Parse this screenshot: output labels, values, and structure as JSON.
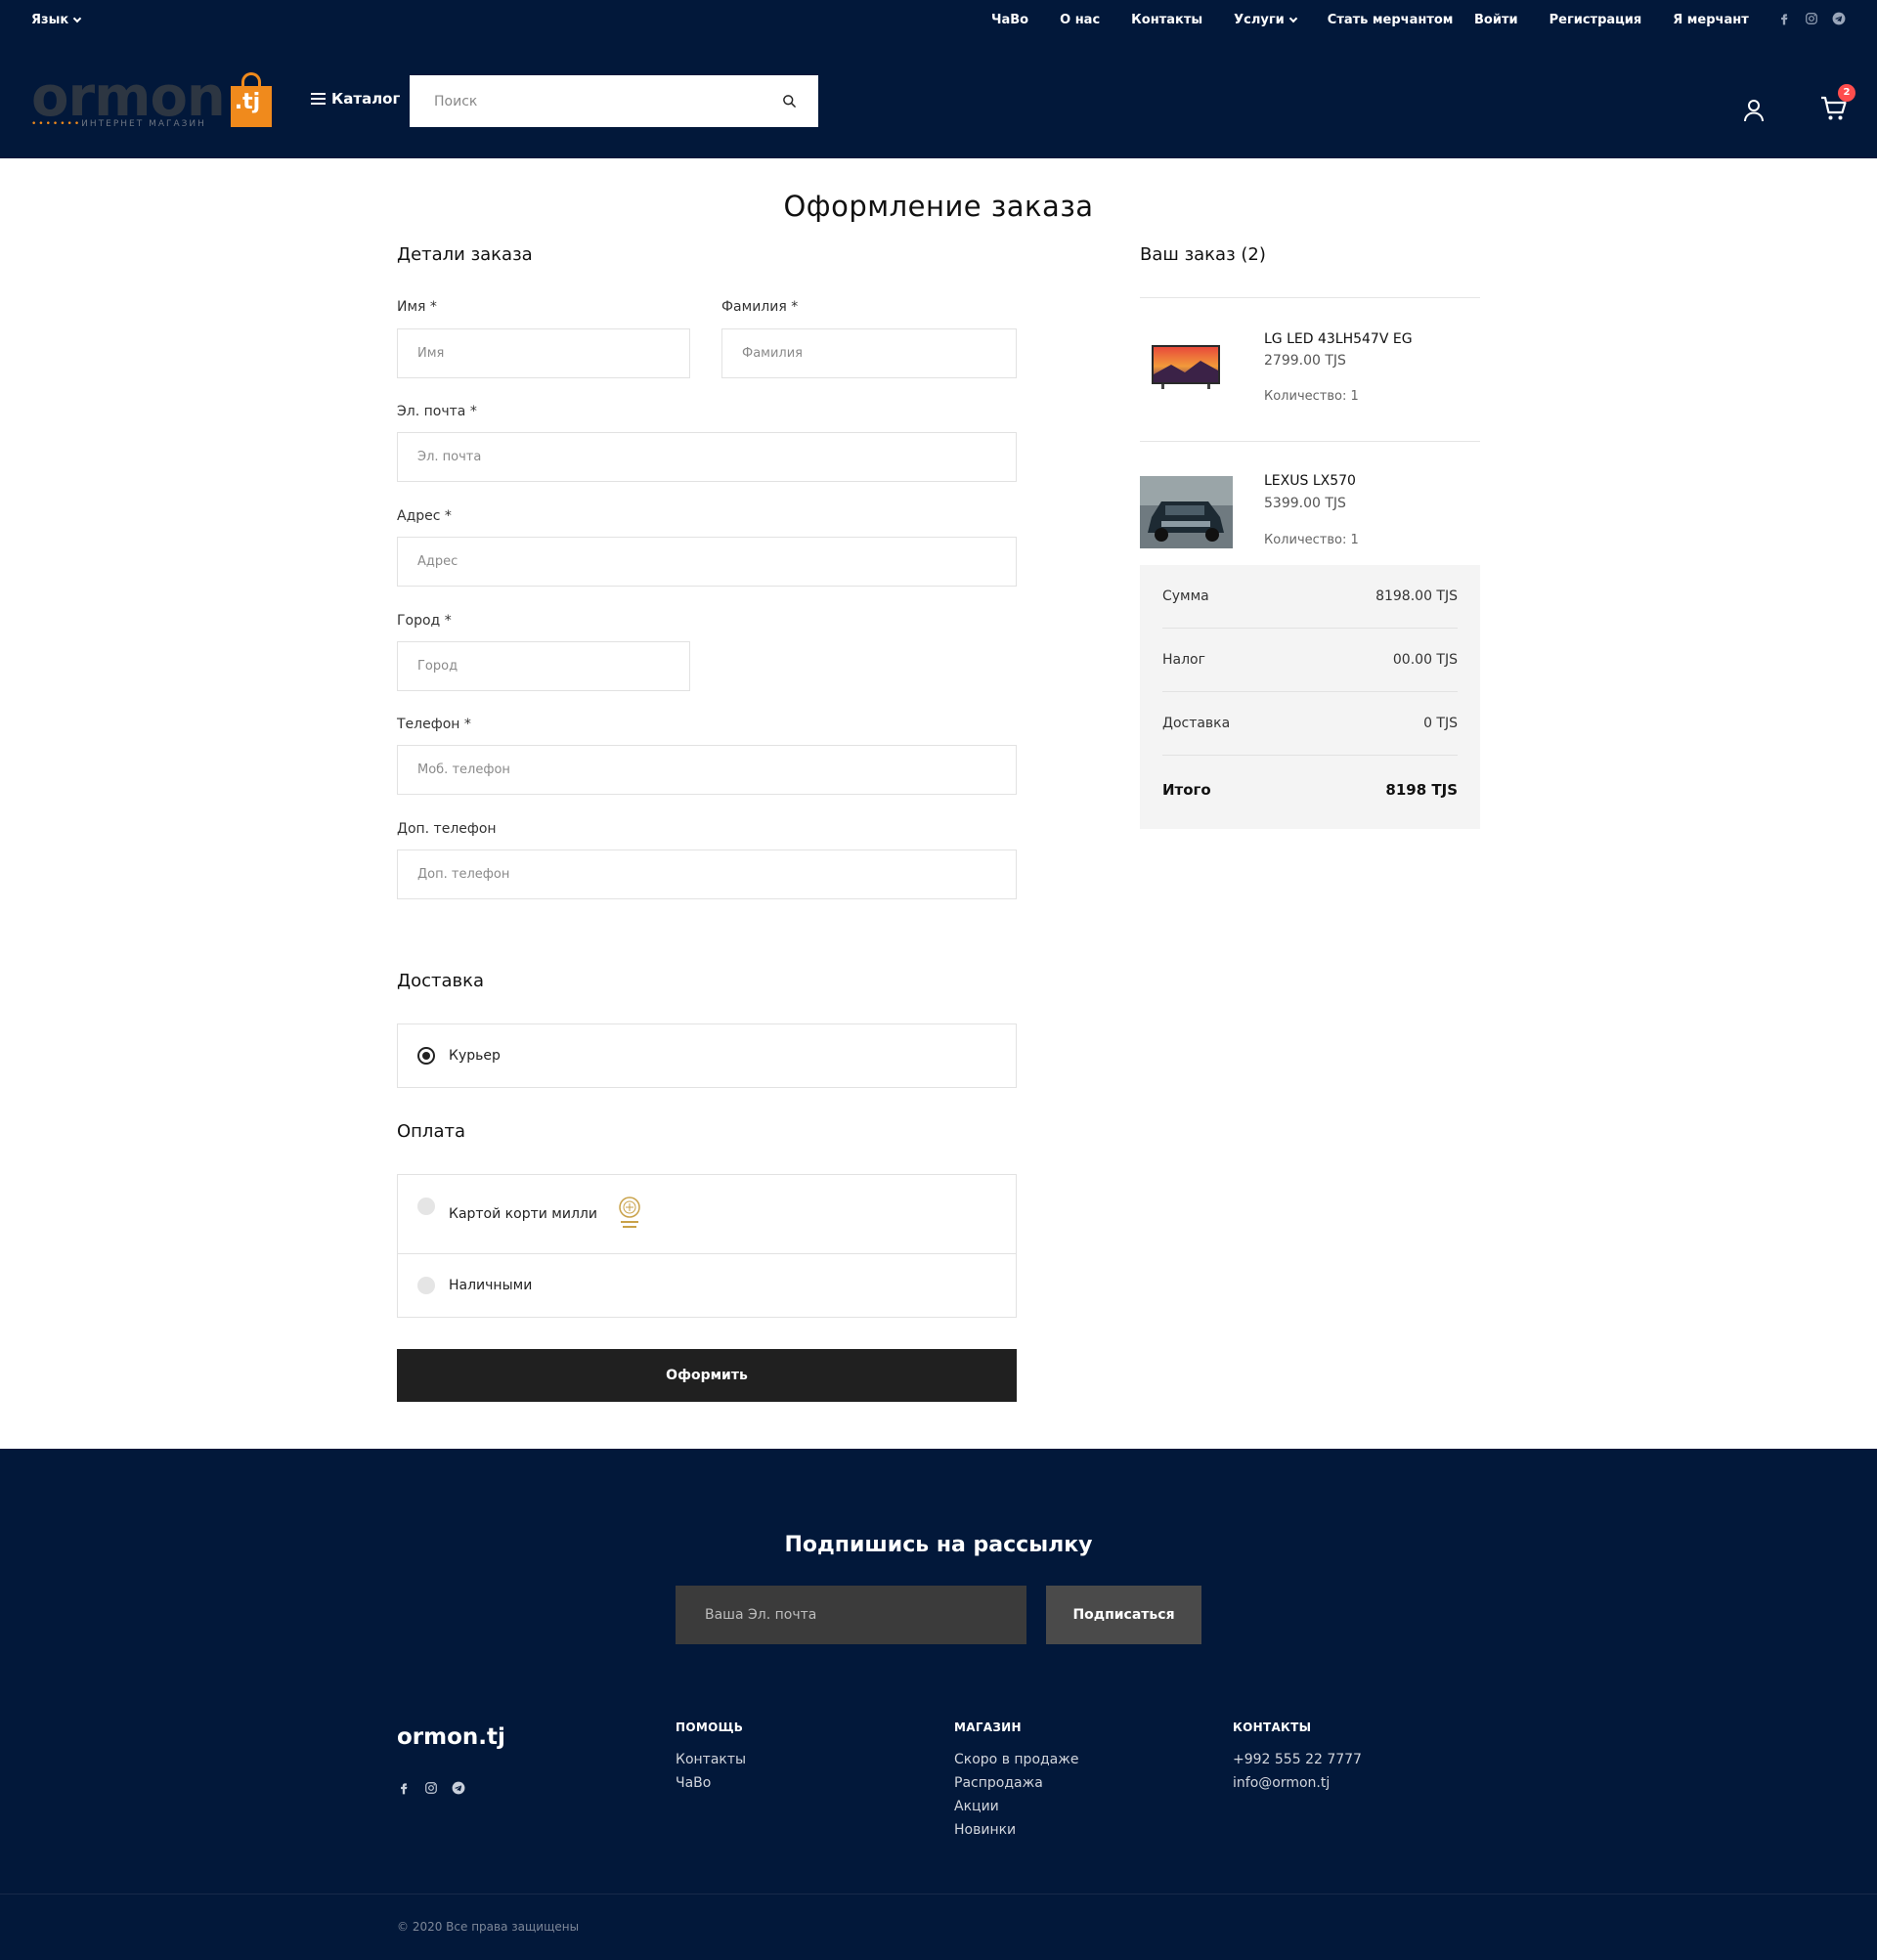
{
  "header": {
    "language_label": "Язык",
    "nav_main": [
      "ЧаВо",
      "О нас",
      "Контакты",
      "Услуги",
      "Стать мерчантом"
    ],
    "nav_auth": [
      "Войти",
      "Регистрация",
      "Я мерчант"
    ],
    "social_icons": [
      "facebook-icon",
      "instagram-icon",
      "telegram-icon"
    ],
    "logo_word": "ormon",
    "logo_suffix": ".tj",
    "logo_tagline": "ИНТЕРНЕТ МАГАЗИН",
    "catalog_label": "Каталог",
    "search_placeholder": "Поиск",
    "cart_count": "2",
    "colors": {
      "navy": "#02183a",
      "accent": "#f08a1c",
      "badge": "#ff4d4d"
    }
  },
  "page": {
    "title": "Оформление заказа"
  },
  "form": {
    "details_title": "Детали заказа",
    "first_name": {
      "label": "Имя",
      "placeholder": "Имя"
    },
    "last_name": {
      "label": "Фамилия",
      "placeholder": "Фамилия"
    },
    "email": {
      "label": "Эл. почта",
      "placeholder": "Эл. почта"
    },
    "address": {
      "label": "Адрес",
      "placeholder": "Адрес"
    },
    "city": {
      "label": "Город",
      "placeholder": "Город"
    },
    "phone": {
      "label": "Телефон",
      "placeholder": "Моб. телефон"
    },
    "extra_phone": {
      "label": "Доп. телефон",
      "placeholder": "Доп. телефон"
    },
    "required_mark": "*",
    "delivery_title": "Доставка",
    "delivery_options": [
      {
        "label": "Курьер",
        "selected": true
      }
    ],
    "payment_title": "Оплата",
    "payment_options": [
      {
        "label": "Картой корти милли",
        "selected": false
      },
      {
        "label": "Наличными",
        "selected": false
      }
    ],
    "submit_label": "Оформить"
  },
  "order": {
    "title": "Ваш заказ (2)",
    "items": [
      {
        "name": "LG LED 43LH547V EG",
        "price": "2799.00 TJS",
        "qty": "Количество: 1"
      },
      {
        "name": "LEXUS LX570",
        "price": "5399.00 TJS",
        "qty": "Количество: 1"
      }
    ],
    "totals": [
      {
        "label": "Сумма",
        "value": "8198.00 TJS"
      },
      {
        "label": "Налог",
        "value": "00.00 TJS"
      },
      {
        "label": "Доставка",
        "value": "0 TJS"
      },
      {
        "label": "Итого",
        "value": "8198 TJS"
      }
    ]
  },
  "footer": {
    "newsletter_title": "Подпишись на рассылку",
    "newsletter_placeholder": "Ваша Эл. почта",
    "newsletter_button": "Подписаться",
    "brand": "ormon.tj",
    "columns": [
      {
        "title": "ПОМОЩЬ",
        "links": [
          "Контакты",
          "ЧаВо"
        ]
      },
      {
        "title": "МАГАЗИН",
        "links": [
          "Скоро в продаже",
          "Распродажа",
          "Акции",
          "Новинки"
        ]
      },
      {
        "title": "КОНТАКТЫ",
        "links": [
          "+992 555 22 7777",
          "info@ormon.tj"
        ]
      }
    ],
    "copyright": "© 2020 Все права защищены"
  }
}
